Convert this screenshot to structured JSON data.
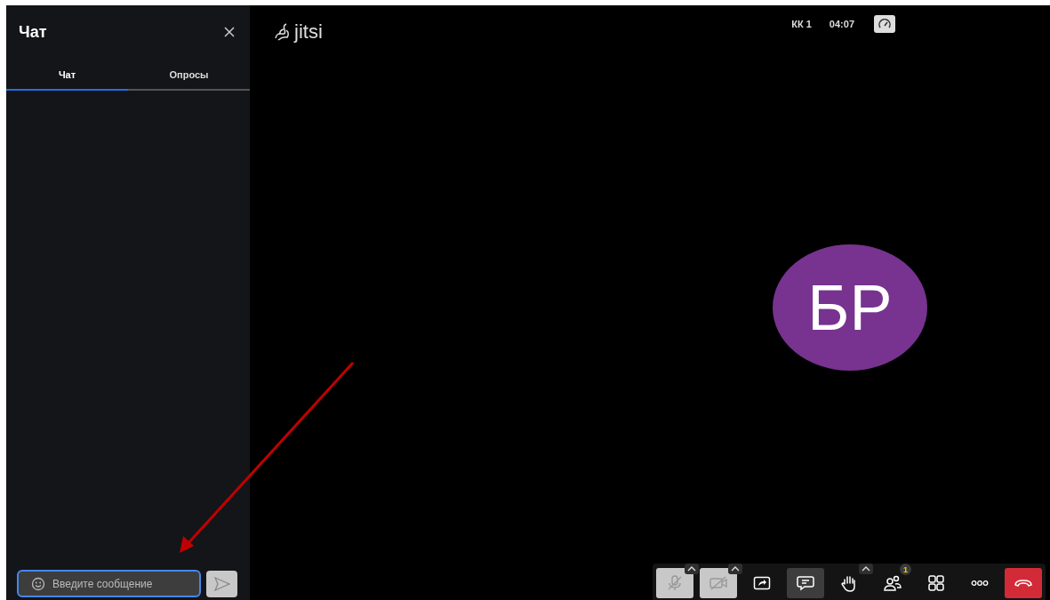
{
  "chat_panel": {
    "title": "Чат",
    "tabs": [
      {
        "label": "Чат",
        "selected": true
      },
      {
        "label": "Опросы",
        "selected": false
      }
    ],
    "message_field": {
      "placeholder": "Введите сообщение"
    },
    "send_button": {
      "disabled": true
    }
  },
  "header": {
    "logo": "jitsi",
    "subject": "КК 1",
    "timer": "04:07"
  },
  "avatar": {
    "initials": "БР"
  },
  "toolbar": [
    {
      "kind": "mic",
      "on": false,
      "menu": true
    },
    {
      "kind": "camera",
      "on": false,
      "menu": true
    },
    {
      "kind": "share",
      "on": false,
      "menu": false
    },
    {
      "kind": "chat",
      "on": true,
      "menu": false
    },
    {
      "kind": "hand",
      "on": false,
      "menu": true
    },
    {
      "kind": "participants",
      "on": false,
      "menu": false,
      "badge": "1"
    },
    {
      "kind": "tiles",
      "on": false,
      "menu": false
    },
    {
      "kind": "more",
      "on": false,
      "menu": false
    },
    {
      "kind": "hangup",
      "on": false,
      "menu": false
    }
  ]
}
